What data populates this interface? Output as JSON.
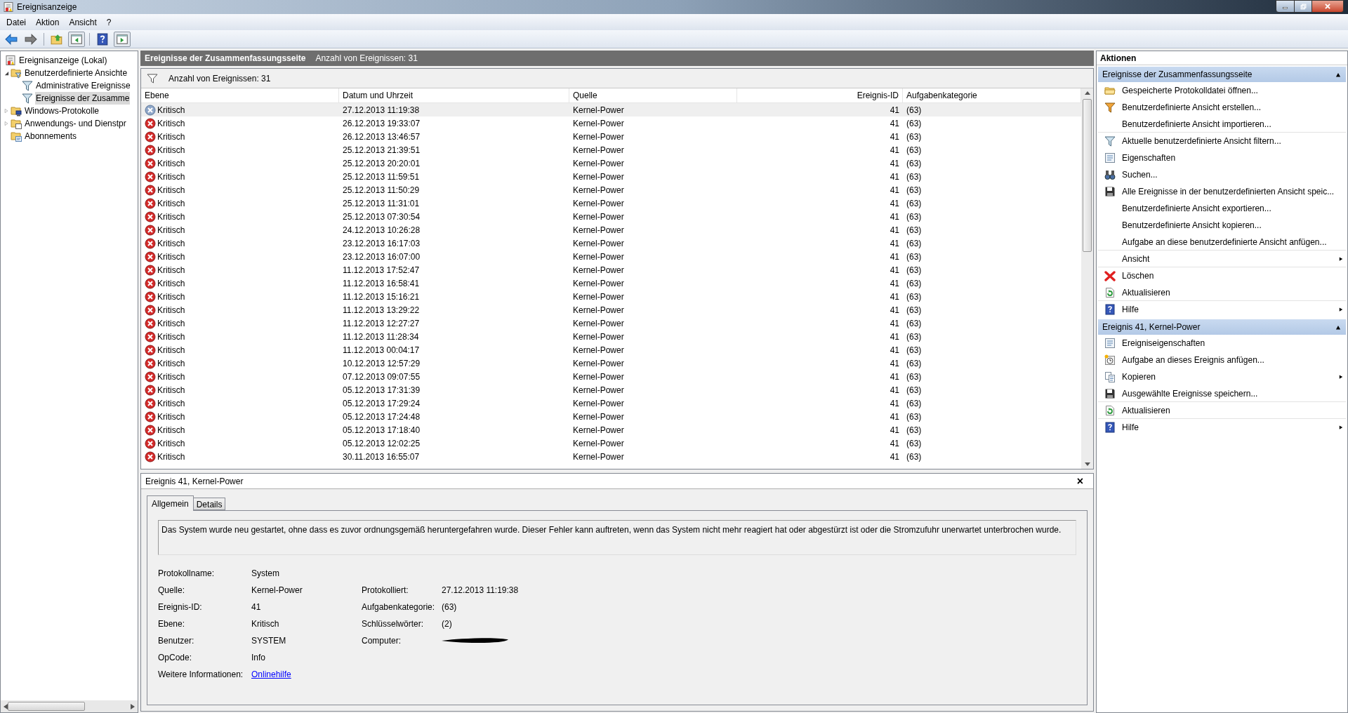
{
  "window": {
    "title": "Ereignisanzeige"
  },
  "menu": [
    "Datei",
    "Aktion",
    "Ansicht",
    "?"
  ],
  "toolbar": [
    {
      "kind": "back",
      "disabled": false
    },
    {
      "kind": "forward",
      "disabled": true
    },
    {
      "kind": "up",
      "disabled": false
    },
    {
      "kind": "pane-left",
      "disabled": false
    },
    {
      "kind": "help",
      "disabled": false
    },
    {
      "kind": "pane-right",
      "disabled": false
    }
  ],
  "tree": [
    {
      "label": "Ereignisanzeige (Lokal)",
      "kind": "viewer",
      "selected": false,
      "children": [
        {
          "label": "Benutzerdefinierte Ansichte",
          "kind": "folder-filter",
          "expanded": true,
          "selected": false,
          "children": [
            {
              "label": "Administrative Ereignisse",
              "kind": "filter",
              "selected": false
            },
            {
              "label": "Ereignisse der Zusamme",
              "kind": "filter",
              "selected": true
            }
          ]
        },
        {
          "label": "Windows-Protokolle",
          "kind": "folder-pc",
          "expanded": false,
          "selected": false
        },
        {
          "label": "Anwendungs- und Dienstpr",
          "kind": "folder-app",
          "expanded": false,
          "selected": false
        },
        {
          "label": "Abonnements",
          "kind": "folder-sub",
          "selected": false
        }
      ]
    }
  ],
  "view": {
    "title": "Ereignisse der Zusammenfassungsseite",
    "count": "Anzahl von Ereignissen: 31",
    "filter_text": "Anzahl von Ereignissen: 31"
  },
  "table": {
    "columns": [
      "Ebene",
      "Datum und Uhrzeit",
      "Quelle",
      "Ereignis-ID",
      "Aufgabenkategorie"
    ],
    "rows": [
      {
        "level": "Kritisch",
        "date": "27.12.2013 11:19:38",
        "source": "Kernel-Power",
        "id": "41",
        "category": "(63)",
        "selected": true
      },
      {
        "level": "Kritisch",
        "date": "26.12.2013 19:33:07",
        "source": "Kernel-Power",
        "id": "41",
        "category": "(63)",
        "selected": false
      },
      {
        "level": "Kritisch",
        "date": "26.12.2013 13:46:57",
        "source": "Kernel-Power",
        "id": "41",
        "category": "(63)",
        "selected": false
      },
      {
        "level": "Kritisch",
        "date": "25.12.2013 21:39:51",
        "source": "Kernel-Power",
        "id": "41",
        "category": "(63)",
        "selected": false
      },
      {
        "level": "Kritisch",
        "date": "25.12.2013 20:20:01",
        "source": "Kernel-Power",
        "id": "41",
        "category": "(63)",
        "selected": false
      },
      {
        "level": "Kritisch",
        "date": "25.12.2013 11:59:51",
        "source": "Kernel-Power",
        "id": "41",
        "category": "(63)",
        "selected": false
      },
      {
        "level": "Kritisch",
        "date": "25.12.2013 11:50:29",
        "source": "Kernel-Power",
        "id": "41",
        "category": "(63)",
        "selected": false
      },
      {
        "level": "Kritisch",
        "date": "25.12.2013 11:31:01",
        "source": "Kernel-Power",
        "id": "41",
        "category": "(63)",
        "selected": false
      },
      {
        "level": "Kritisch",
        "date": "25.12.2013 07:30:54",
        "source": "Kernel-Power",
        "id": "41",
        "category": "(63)",
        "selected": false
      },
      {
        "level": "Kritisch",
        "date": "24.12.2013 10:26:28",
        "source": "Kernel-Power",
        "id": "41",
        "category": "(63)",
        "selected": false
      },
      {
        "level": "Kritisch",
        "date": "23.12.2013 16:17:03",
        "source": "Kernel-Power",
        "id": "41",
        "category": "(63)",
        "selected": false
      },
      {
        "level": "Kritisch",
        "date": "23.12.2013 16:07:00",
        "source": "Kernel-Power",
        "id": "41",
        "category": "(63)",
        "selected": false
      },
      {
        "level": "Kritisch",
        "date": "11.12.2013 17:52:47",
        "source": "Kernel-Power",
        "id": "41",
        "category": "(63)",
        "selected": false
      },
      {
        "level": "Kritisch",
        "date": "11.12.2013 16:58:41",
        "source": "Kernel-Power",
        "id": "41",
        "category": "(63)",
        "selected": false
      },
      {
        "level": "Kritisch",
        "date": "11.12.2013 15:16:21",
        "source": "Kernel-Power",
        "id": "41",
        "category": "(63)",
        "selected": false
      },
      {
        "level": "Kritisch",
        "date": "11.12.2013 13:29:22",
        "source": "Kernel-Power",
        "id": "41",
        "category": "(63)",
        "selected": false
      },
      {
        "level": "Kritisch",
        "date": "11.12.2013 12:27:27",
        "source": "Kernel-Power",
        "id": "41",
        "category": "(63)",
        "selected": false
      },
      {
        "level": "Kritisch",
        "date": "11.12.2013 11:28:34",
        "source": "Kernel-Power",
        "id": "41",
        "category": "(63)",
        "selected": false
      },
      {
        "level": "Kritisch",
        "date": "11.12.2013 00:04:17",
        "source": "Kernel-Power",
        "id": "41",
        "category": "(63)",
        "selected": false
      },
      {
        "level": "Kritisch",
        "date": "10.12.2013 12:57:29",
        "source": "Kernel-Power",
        "id": "41",
        "category": "(63)",
        "selected": false
      },
      {
        "level": "Kritisch",
        "date": "07.12.2013 09:07:55",
        "source": "Kernel-Power",
        "id": "41",
        "category": "(63)",
        "selected": false
      },
      {
        "level": "Kritisch",
        "date": "05.12.2013 17:31:39",
        "source": "Kernel-Power",
        "id": "41",
        "category": "(63)",
        "selected": false
      },
      {
        "level": "Kritisch",
        "date": "05.12.2013 17:29:24",
        "source": "Kernel-Power",
        "id": "41",
        "category": "(63)",
        "selected": false
      },
      {
        "level": "Kritisch",
        "date": "05.12.2013 17:24:48",
        "source": "Kernel-Power",
        "id": "41",
        "category": "(63)",
        "selected": false
      },
      {
        "level": "Kritisch",
        "date": "05.12.2013 17:18:40",
        "source": "Kernel-Power",
        "id": "41",
        "category": "(63)",
        "selected": false
      },
      {
        "level": "Kritisch",
        "date": "05.12.2013 12:02:25",
        "source": "Kernel-Power",
        "id": "41",
        "category": "(63)",
        "selected": false
      },
      {
        "level": "Kritisch",
        "date": "30.11.2013 16:55:07",
        "source": "Kernel-Power",
        "id": "41",
        "category": "(63)",
        "selected": false
      }
    ]
  },
  "details": {
    "title": "Ereignis 41, Kernel-Power",
    "close": "×",
    "tabs": [
      {
        "label": "Allgemein",
        "selected": true
      },
      {
        "label": "Details",
        "selected": false
      }
    ],
    "description": "Das System wurde neu gestartet, ohne dass es zuvor ordnungsgemäß heruntergefahren wurde. Dieser Fehler kann auftreten, wenn das System nicht mehr reagiert hat oder abgestürzt ist oder die Stromzufuhr unerwartet unterbrochen wurde.",
    "left_fields": [
      {
        "label": "Protokollname:",
        "value": "System"
      },
      {
        "label": "Quelle:",
        "value": "Kernel-Power"
      },
      {
        "label": "Ereignis-ID:",
        "value": "41"
      },
      {
        "label": "Ebene:",
        "value": "Kritisch"
      },
      {
        "label": "Benutzer:",
        "value": "SYSTEM"
      },
      {
        "label": "OpCode:",
        "value": "Info"
      },
      {
        "label": "Weitere Informationen:",
        "value": "Onlinehilfe",
        "kind": "link"
      }
    ],
    "right_fields": [
      {
        "label": "Protokolliert:",
        "value": "27.12.2013 11:19:38"
      },
      {
        "label": "Aufgabenkategorie:",
        "value": "(63)"
      },
      {
        "label": "Schlüsselwörter:",
        "value": "(2)"
      },
      {
        "label": "Computer:",
        "redacted": true
      }
    ]
  },
  "actions": {
    "title": "Aktionen",
    "sections": [
      {
        "title": "Ereignisse der Zusammenfassungsseite",
        "expanded": true,
        "items": [
          {
            "label": "Gespeicherte Protokolldatei öffnen...",
            "kind": "folder"
          },
          {
            "label": "Benutzerdefinierte Ansicht erstellen...",
            "kind": "filter-color"
          },
          {
            "label": "Benutzerdefinierte Ansicht importieren...",
            "kind": "plain",
            "divider_after": true
          },
          {
            "label": "Aktuelle benutzerdefinierte Ansicht filtern...",
            "kind": "filter"
          },
          {
            "label": "Eigenschaften",
            "kind": "properties"
          },
          {
            "label": "Suchen...",
            "kind": "binoculars"
          },
          {
            "label": "Alle Ereignisse in der benutzerdefinierten Ansicht speic...",
            "kind": "save"
          },
          {
            "label": "Benutzerdefinierte Ansicht exportieren...",
            "kind": "plain"
          },
          {
            "label": "Benutzerdefinierte Ansicht kopieren...",
            "kind": "plain"
          },
          {
            "label": "Aufgabe an diese benutzerdefinierte Ansicht anfügen...",
            "kind": "plain",
            "divider_after": true
          },
          {
            "label": "Ansicht",
            "kind": "plain",
            "submenu": true,
            "divider_after": true
          },
          {
            "label": "Löschen",
            "kind": "delete"
          },
          {
            "label": "Aktualisieren",
            "kind": "refresh",
            "divider_after": true
          },
          {
            "label": "Hilfe",
            "kind": "help",
            "submenu": true
          }
        ]
      },
      {
        "title": "Ereignis 41, Kernel-Power",
        "expanded": true,
        "items": [
          {
            "label": "Ereigniseigenschaften",
            "kind": "properties"
          },
          {
            "label": "Aufgabe an dieses Ereignis anfügen...",
            "kind": "task"
          },
          {
            "label": "Kopieren",
            "kind": "copy",
            "submenu": true
          },
          {
            "label": "Ausgewählte Ereignisse speichern...",
            "kind": "save",
            "divider_after": true
          },
          {
            "label": "Aktualisieren",
            "kind": "refresh",
            "divider_after": true
          },
          {
            "label": "Hilfe",
            "kind": "help",
            "submenu": true
          }
        ]
      }
    ]
  }
}
